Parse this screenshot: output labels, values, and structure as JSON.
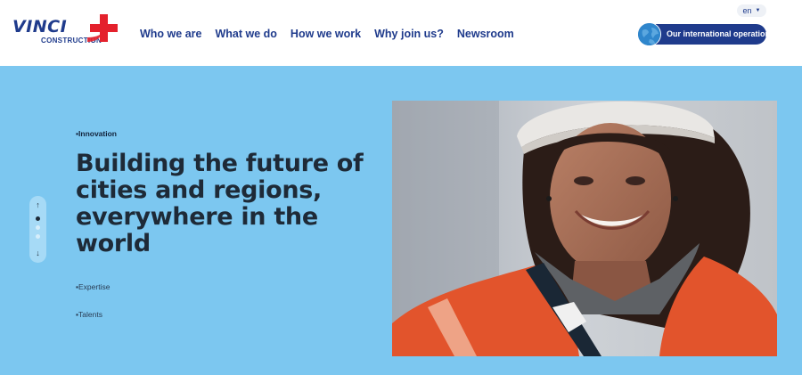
{
  "brand": {
    "name": "VINCI",
    "sub": "CONSTRUCTION",
    "primary": "#1f3b8c",
    "accent": "#e4212c"
  },
  "nav": {
    "items": [
      {
        "label": "Who we are"
      },
      {
        "label": "What we do"
      },
      {
        "label": "How we work"
      },
      {
        "label": "Why join us?"
      },
      {
        "label": "Newsroom"
      }
    ]
  },
  "header": {
    "language": "en",
    "language_icon": "chevron-down-icon",
    "international_label": "Our international operations",
    "international_icon": "globe-icon"
  },
  "hero": {
    "background": "#7cc7f0",
    "tags": {
      "innovation": "▪Innovation",
      "expertise": "▪Expertise",
      "talents": "▪Talents"
    },
    "headline": "Building the future of cities and regions, everywhere in the world",
    "pager": {
      "up": "↑",
      "down": "↓",
      "active_index": 0,
      "count": 3
    },
    "image_subject": "construction worker in hard hat and orange high-visibility jacket"
  }
}
